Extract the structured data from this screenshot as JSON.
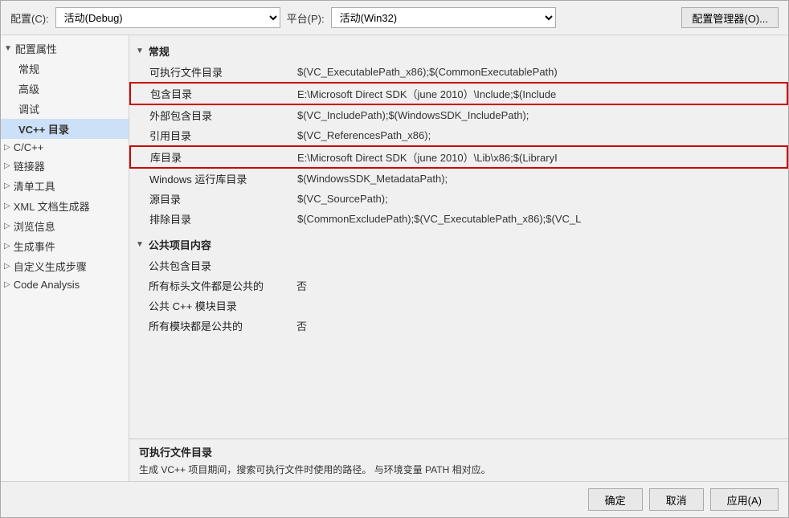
{
  "toolbar": {
    "config_label": "配置(C):",
    "config_value": "活动(Debug)",
    "platform_label": "平台(P):",
    "platform_value": "活动(Win32)",
    "config_manager_label": "配置管理器(O)..."
  },
  "sidebar": {
    "root_label": "配置属性",
    "items": [
      {
        "label": "常规",
        "indent": 1
      },
      {
        "label": "高级",
        "indent": 1
      },
      {
        "label": "调试",
        "indent": 1
      },
      {
        "label": "VC++ 目录",
        "indent": 1,
        "selected": true
      },
      {
        "label": "C/C++",
        "indent": 0,
        "expandable": true
      },
      {
        "label": "链接器",
        "indent": 0,
        "expandable": true
      },
      {
        "label": "清单工具",
        "indent": 0,
        "expandable": true
      },
      {
        "label": "XML 文档生成器",
        "indent": 0,
        "expandable": true
      },
      {
        "label": "浏览信息",
        "indent": 0,
        "expandable": true
      },
      {
        "label": "生成事件",
        "indent": 0,
        "expandable": true
      },
      {
        "label": "自定义生成步骤",
        "indent": 0,
        "expandable": true
      },
      {
        "label": "Code Analysis",
        "indent": 0,
        "expandable": true
      }
    ]
  },
  "sections": [
    {
      "title": "常规",
      "rows": [
        {
          "name": "可执行文件目录",
          "value": "$(VC_ExecutablePath_x86);$(CommonExecutablePath)",
          "highlighted": false
        },
        {
          "name": "包含目录",
          "value": "E:\\Microsoft Direct SDK（june 2010）\\Include;$(Include",
          "highlighted": true
        },
        {
          "name": "外部包含目录",
          "value": "$(VC_IncludePath);$(WindowsSDK_IncludePath);",
          "highlighted": false
        },
        {
          "name": "引用目录",
          "value": "$(VC_ReferencesPath_x86);",
          "highlighted": false
        },
        {
          "name": "库目录",
          "value": "E:\\Microsoft Direct SDK（june 2010）\\Lib\\x86;$(LibraryI",
          "highlighted": true
        },
        {
          "name": "Windows 运行库目录",
          "value": "$(WindowsSDK_MetadataPath);",
          "highlighted": false
        },
        {
          "name": "源目录",
          "value": "$(VC_SourcePath);",
          "highlighted": false
        },
        {
          "name": "排除目录",
          "value": "$(CommonExcludePath);$(VC_ExecutablePath_x86);$(VC_L",
          "highlighted": false
        }
      ]
    },
    {
      "title": "公共项目内容",
      "rows": [
        {
          "name": "公共包含目录",
          "value": "",
          "highlighted": false
        },
        {
          "name": "所有标头文件都是公共的",
          "value": "否",
          "highlighted": false
        },
        {
          "name": "公共 C++ 模块目录",
          "value": "",
          "highlighted": false
        },
        {
          "name": "所有模块都是公共的",
          "value": "否",
          "highlighted": false
        }
      ]
    }
  ],
  "status": {
    "title": "可执行文件目录",
    "description": "生成 VC++ 项目期间，搜索可执行文件时使用的路径。 与环境变量 PATH 相对应。"
  },
  "buttons": {
    "ok": "确定",
    "cancel": "取消",
    "apply": "应用(A)"
  }
}
